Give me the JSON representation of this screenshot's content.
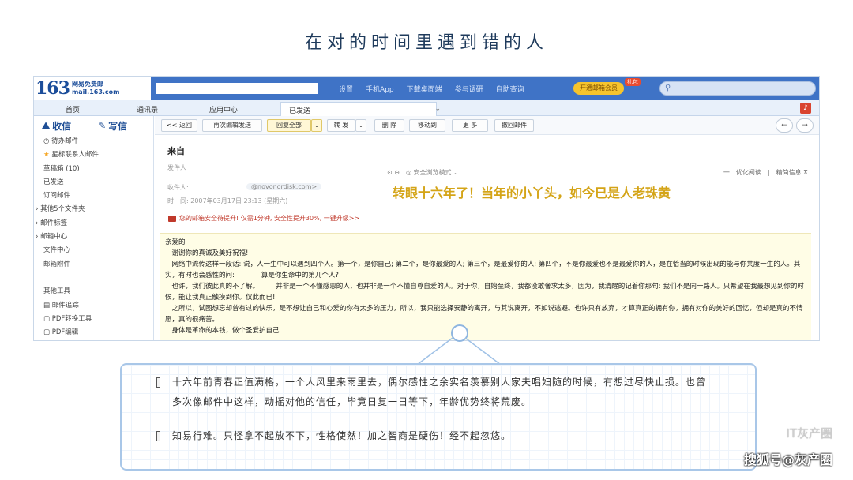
{
  "page": {
    "title": "在对的时间里遇到错的人"
  },
  "mail_client": {
    "logo": {
      "number": "163",
      "line1": "网易免费邮",
      "line2": "mail.163.com"
    },
    "top_links": [
      "设置",
      "手机App",
      "下载桌面端",
      "参与调研",
      "自助查询"
    ],
    "open_vip": "开通邮箱会员",
    "vip_badge": "礼包",
    "nav_tabs": [
      "首页",
      "通讯录",
      "应用中心",
      "已发送"
    ],
    "sidebar": {
      "receive": "收信",
      "compose": "写信",
      "items": [
        "待办邮件",
        "星标联系人邮件",
        "草稿箱 (10)",
        "已发送",
        "订阅邮件",
        "其他5个文件夹",
        "邮件标签",
        "邮箱中心",
        "文件中心",
        "邮箱附件",
        "",
        "其他工具",
        "邮件追踪",
        "PDF转换工具",
        "PDF编辑"
      ]
    },
    "toolbar": {
      "back": "<< 返回",
      "resend": "再次编辑发送",
      "reply_all": "回复全部",
      "forward": "转 发",
      "delete": "删 除",
      "move": "移动到",
      "more": "更 多",
      "recall": "撤回邮件"
    },
    "headers": {
      "from_label": "来自",
      "sender_label": "发件人",
      "recipient_label": "收件人:",
      "recipient_email": "@novonordisk.com>",
      "time": "时　间: 2007年03月17日 23:13 (星期六)",
      "icons_text": "⊙ ⊖　◎ 安全浏览模式 ⌄",
      "right_text": "一　优化阅读　|　精简信息 ⊼"
    },
    "security_notice": "您的邮箱安全待提升! 仅需1分钟, 安全性提升30%, 一键升级>>",
    "annotation": "转眼十六年了！当年的小丫头，如今已是人老珠黄",
    "letter": [
      "亲爱的",
      "　谢谢你的真诚及美好祝福!",
      "　网络中流传这样一段话: 说，人一生中可以遇到四个人。第一个，是你自己; 第二个，是你最爱的人; 第三个，是最爱你的人; 第四个，不是你最爱也不是最爱你的人，是在恰当的时候出现的能与你共度一生的人。其实，有时也会感性的问:　　　　算是你生命中的第几个人?",
      "　也许，我们彼此真的不了解。　　　并非是一个不懂感恩的人，也并非是一个不懂自尊自爱的人。对于你，自始至终，我都没敢奢求太多，因为，我清醒的记着你那句: 我们不是同一路人。只希望在我最想见到你的时候，能让我真正触摸到你。仅此而已!",
      "　之所以，试图想忘却曾有过的快乐，是不想让自己和心爱的你有太多的压力，所以，我只能选择安静的离开，与其说离开，不如说逃避。也许只有放弃，才算真正的拥有你，拥有对你的美好的回忆，但却是真的不情愿，真的很痛苦。",
      "　身体是革命的本钱，做个圣爱护自己"
    ]
  },
  "note": {
    "paragraph1": "十六年前青春正值满格，一个人风里来雨里去，偶尔感性之余实名羡慕别人家夫唱妇随的时候，有想过尽快止损。也曾多次像邮件中这样，动摇对他的信任，毕竟日复一日等下，年龄优势终将荒废。",
    "paragraph2": "知易行难。只怪拿不起放不下，性格使然！加之智商是硬伤！经不起忽悠。"
  },
  "watermark": {
    "line1": "IT灰产圈",
    "line2": "搜狐号@灰产圈"
  }
}
